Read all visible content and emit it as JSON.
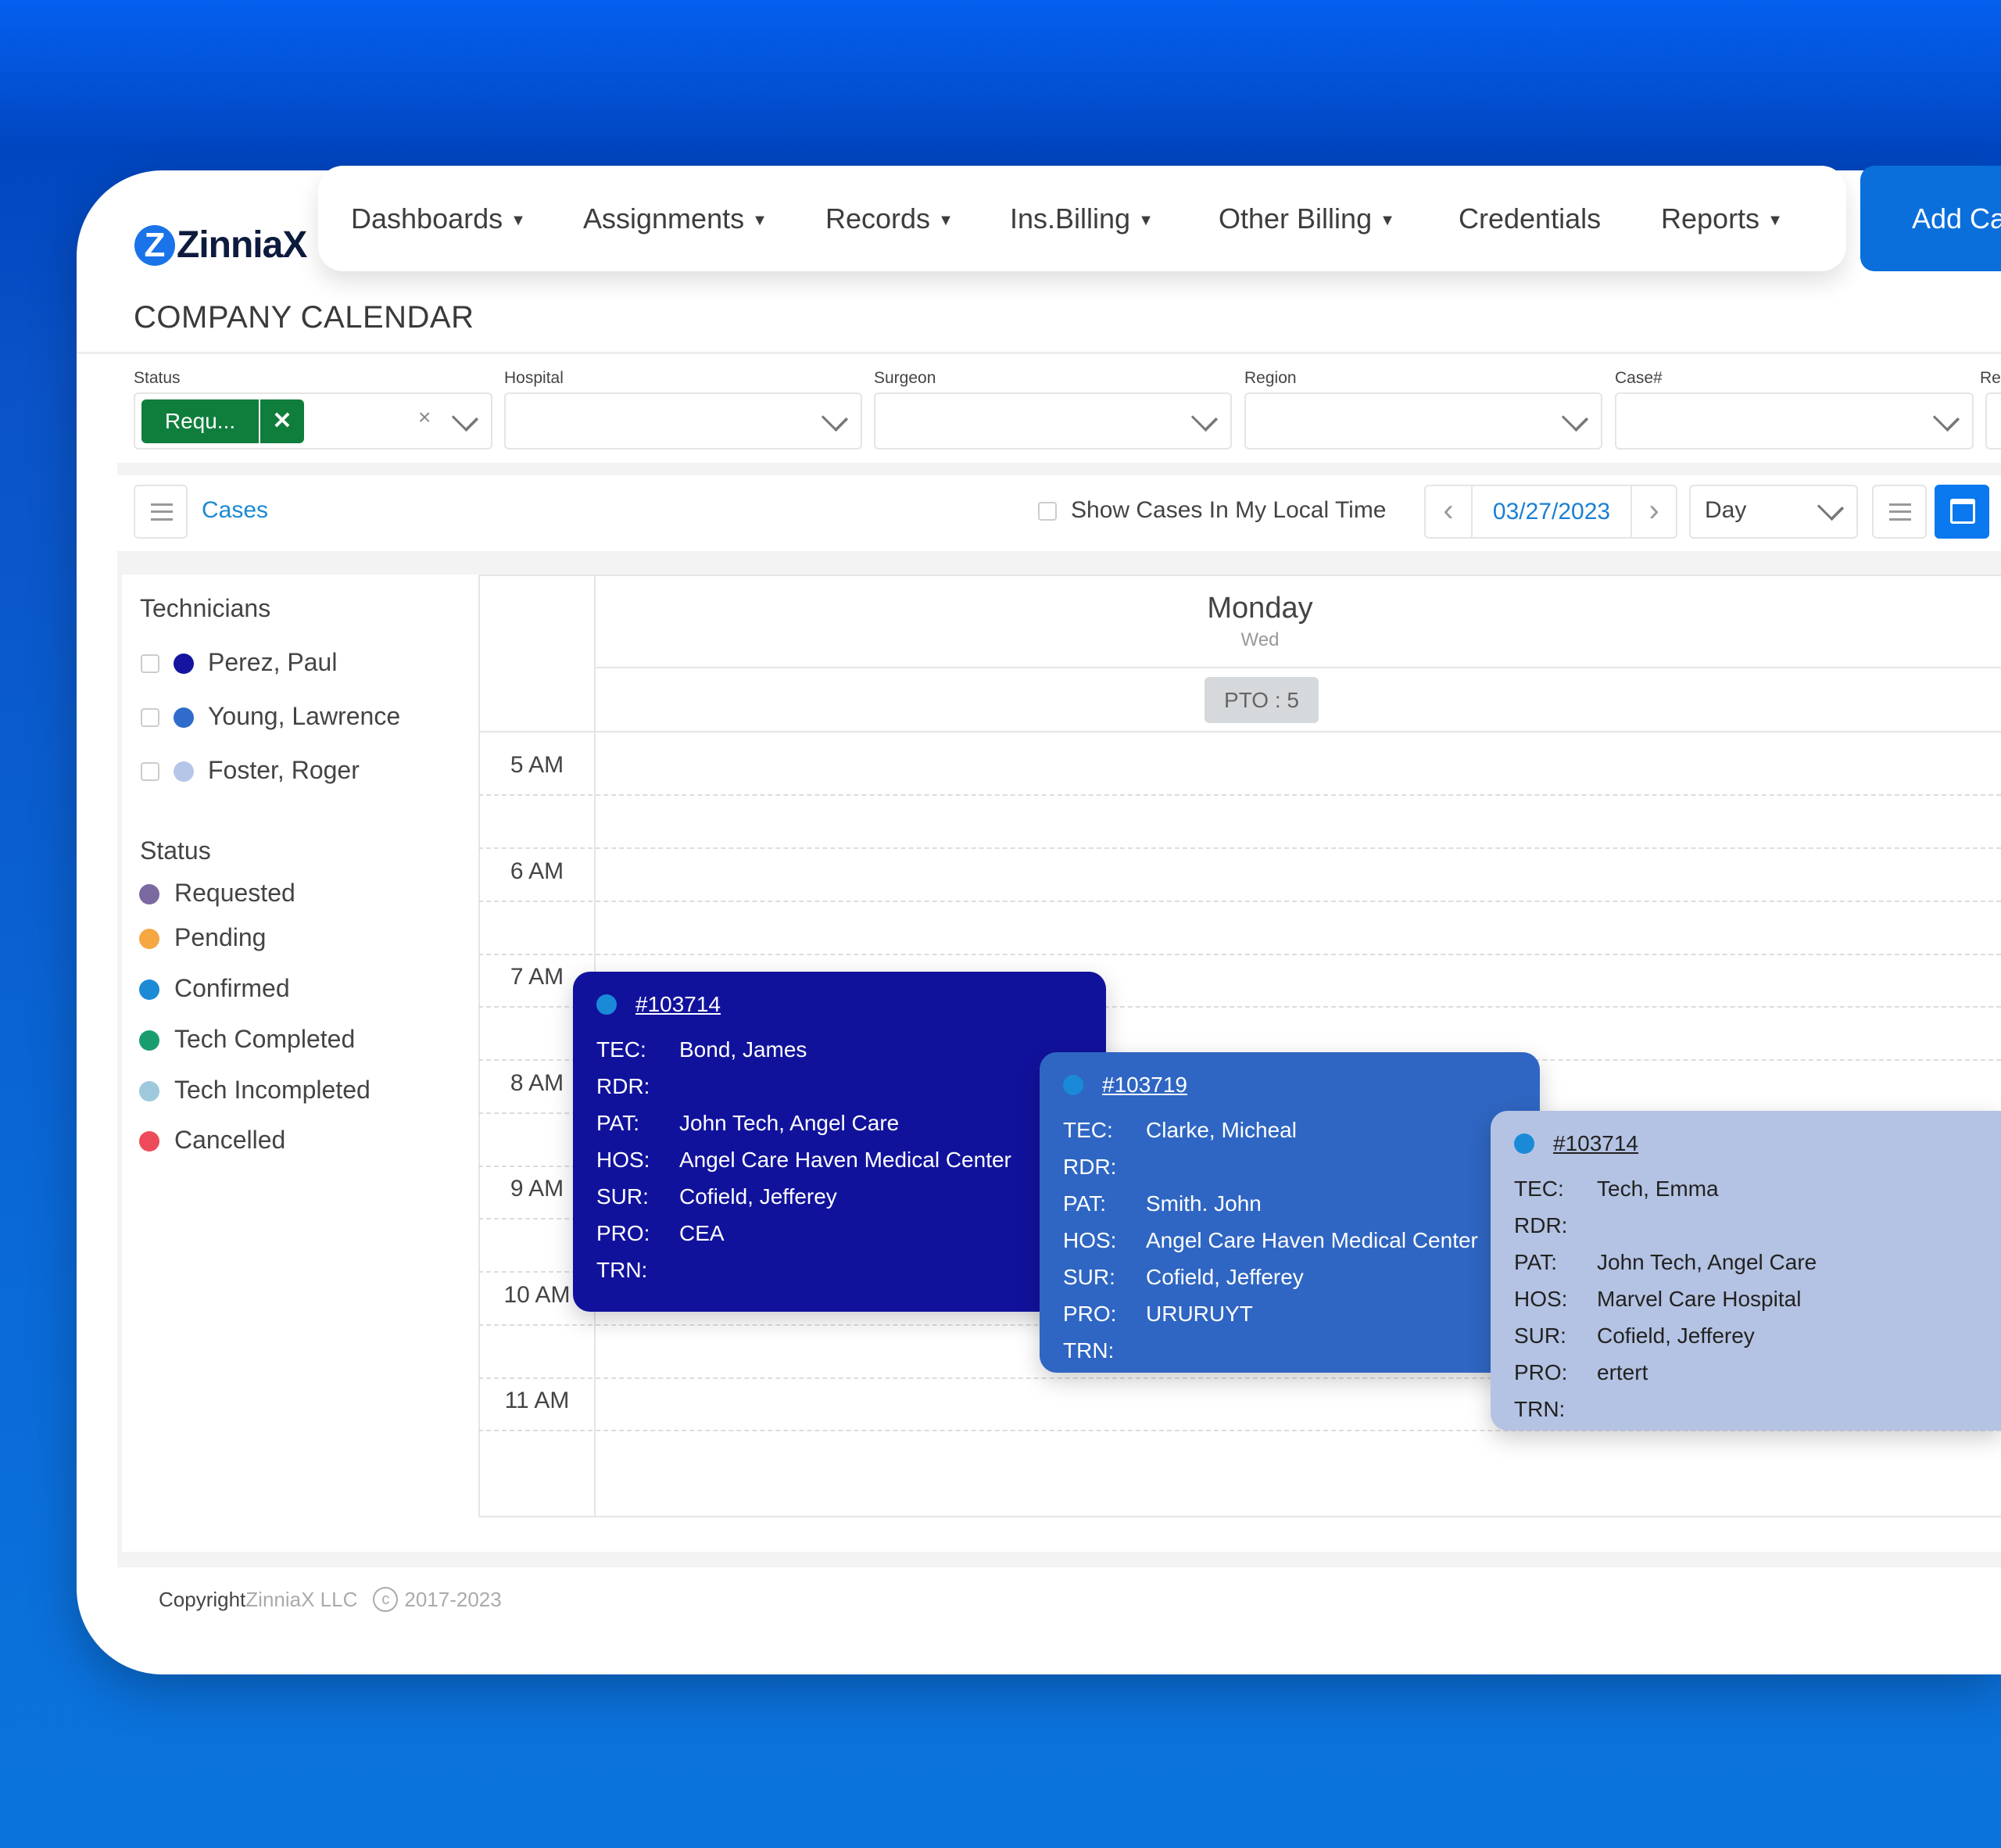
{
  "brand": {
    "name": "ZinniaX",
    "logo_letter": "Z"
  },
  "nav": {
    "items": [
      {
        "label": "Dashboards",
        "caret": true
      },
      {
        "label": "Assignments",
        "caret": true
      },
      {
        "label": "Records",
        "caret": true
      },
      {
        "label": "Ins.Billing",
        "caret": true
      },
      {
        "label": "Other Billing",
        "caret": true
      },
      {
        "label": "Credentials",
        "caret": false
      },
      {
        "label": "Reports",
        "caret": true
      }
    ],
    "add_button": "Add Ca"
  },
  "page_title": "COMPANY CALENDAR",
  "filters": {
    "status": {
      "label": "Status",
      "chip": "Requ...",
      "chip_remove": "✕",
      "clear": "×"
    },
    "hospital": {
      "label": "Hospital"
    },
    "surgeon": {
      "label": "Surgeon"
    },
    "region": {
      "label": "Region"
    },
    "case": {
      "label": "Case#"
    },
    "extra": {
      "label": "Re"
    }
  },
  "toolbar": {
    "cases_label": "Cases",
    "local_time_label": "Show Cases In My Local Time",
    "local_time_checked": false,
    "date": "03/27/2023",
    "prev": "‹",
    "next": "›",
    "view": "Day"
  },
  "sidebar": {
    "technicians_heading": "Technicians",
    "technicians": [
      {
        "name": "Perez, Paul",
        "color": "#1414a0"
      },
      {
        "name": "Young, Lawrence",
        "color": "#2f6ccb"
      },
      {
        "name": "Foster, Roger",
        "color": "#b5c6e8"
      }
    ],
    "status_heading": "Status",
    "statuses": [
      {
        "label": "Requested",
        "color": "#7b6aa0"
      },
      {
        "label": "Pending",
        "color": "#f5a742"
      },
      {
        "label": "Confirmed",
        "color": "#1c8ad4"
      },
      {
        "label": "Tech Completed",
        "color": "#1a9d6c"
      },
      {
        "label": "Tech Incompleted",
        "color": "#9ec9dc"
      },
      {
        "label": "Cancelled",
        "color": "#ee4b5a"
      }
    ]
  },
  "calendar": {
    "day": "Monday",
    "subday": "Wed",
    "pto": "PTO : 5",
    "hours": [
      "5 AM",
      "6 AM",
      "7 AM",
      "8 AM",
      "9 AM",
      "10 AM",
      "11 AM"
    ],
    "events": [
      {
        "id": "#103714",
        "color": "#11129c",
        "text_color": "#ffffff",
        "fields": [
          [
            "TEC:",
            "Bond, James"
          ],
          [
            "RDR:",
            ""
          ],
          [
            "PAT:",
            "John Tech, Angel Care"
          ],
          [
            "HOS:",
            "Angel Care Haven Medical Center"
          ],
          [
            "SUR:",
            "Cofield, Jefferey"
          ],
          [
            "PRO:",
            "CEA"
          ],
          [
            "TRN:",
            ""
          ]
        ]
      },
      {
        "id": "#103719",
        "color": "#2f66c3",
        "text_color": "#ffffff",
        "fields": [
          [
            "TEC:",
            "Clarke, Micheal"
          ],
          [
            "RDR:",
            ""
          ],
          [
            "PAT:",
            "Smith. John"
          ],
          [
            "HOS:",
            "Angel Care Haven Medical Center"
          ],
          [
            "SUR:",
            "Cofield, Jefferey"
          ],
          [
            "PRO:",
            "URURUYT"
          ],
          [
            "TRN:",
            ""
          ]
        ]
      },
      {
        "id": "#103714",
        "color": "#b4c3e3",
        "text_color": "#222222",
        "fields": [
          [
            "TEC:",
            "Tech, Emma"
          ],
          [
            "RDR:",
            ""
          ],
          [
            "PAT:",
            "John Tech, Angel Care"
          ],
          [
            "HOS:",
            "Marvel Care Hospital"
          ],
          [
            "SUR:",
            "Cofield, Jefferey"
          ],
          [
            "PRO:",
            "ertert"
          ],
          [
            "TRN:",
            ""
          ]
        ]
      }
    ]
  },
  "footer": {
    "copyright": "Copyright",
    "company": "ZinniaX LLC",
    "symbol": "c",
    "years": "2017-2023"
  }
}
